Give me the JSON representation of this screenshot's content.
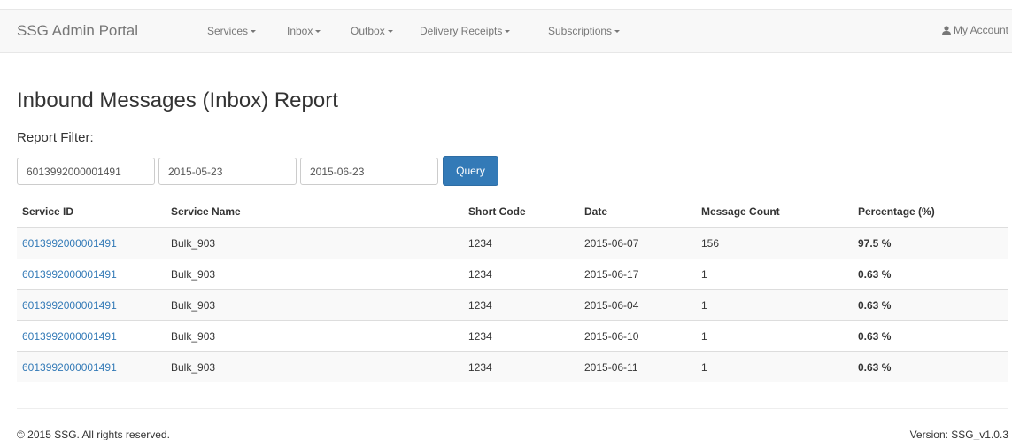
{
  "navbar": {
    "brand": "SSG Admin Portal",
    "menus": [
      "Services",
      "Inbox",
      "Outbox",
      "Delivery Receipts",
      "Subscriptions"
    ],
    "account_label": "My Account",
    "account_icon": "user-icon"
  },
  "page": {
    "title": "Inbound Messages (Inbox) Report",
    "filter_label": "Report Filter:"
  },
  "filter": {
    "service_id": "6013992000001491",
    "start_date": "2015-05-23",
    "end_date": "2015-06-23",
    "query_label": "Query"
  },
  "table": {
    "headers": [
      "Service ID",
      "Service Name",
      "Short Code",
      "Date",
      "Message Count",
      "Percentage (%)"
    ],
    "rows": [
      {
        "service_id": "6013992000001491",
        "service_name": "Bulk_903",
        "short_code": "1234",
        "date": "2015-06-07",
        "count": "156",
        "pct": "97.5 %"
      },
      {
        "service_id": "6013992000001491",
        "service_name": "Bulk_903",
        "short_code": "1234",
        "date": "2015-06-17",
        "count": "1",
        "pct": "0.63 %"
      },
      {
        "service_id": "6013992000001491",
        "service_name": "Bulk_903",
        "short_code": "1234",
        "date": "2015-06-04",
        "count": "1",
        "pct": "0.63 %"
      },
      {
        "service_id": "6013992000001491",
        "service_name": "Bulk_903",
        "short_code": "1234",
        "date": "2015-06-10",
        "count": "1",
        "pct": "0.63 %"
      },
      {
        "service_id": "6013992000001491",
        "service_name": "Bulk_903",
        "short_code": "1234",
        "date": "2015-06-11",
        "count": "1",
        "pct": "0.63 %"
      }
    ]
  },
  "footer": {
    "copyright": "© 2015 SSG. All rights reserved.",
    "version": "Version: SSG_v1.0.3"
  },
  "colors": {
    "link": "#337ab7",
    "primary_button": "#337ab7",
    "navbar_bg": "#f8f8f8"
  }
}
